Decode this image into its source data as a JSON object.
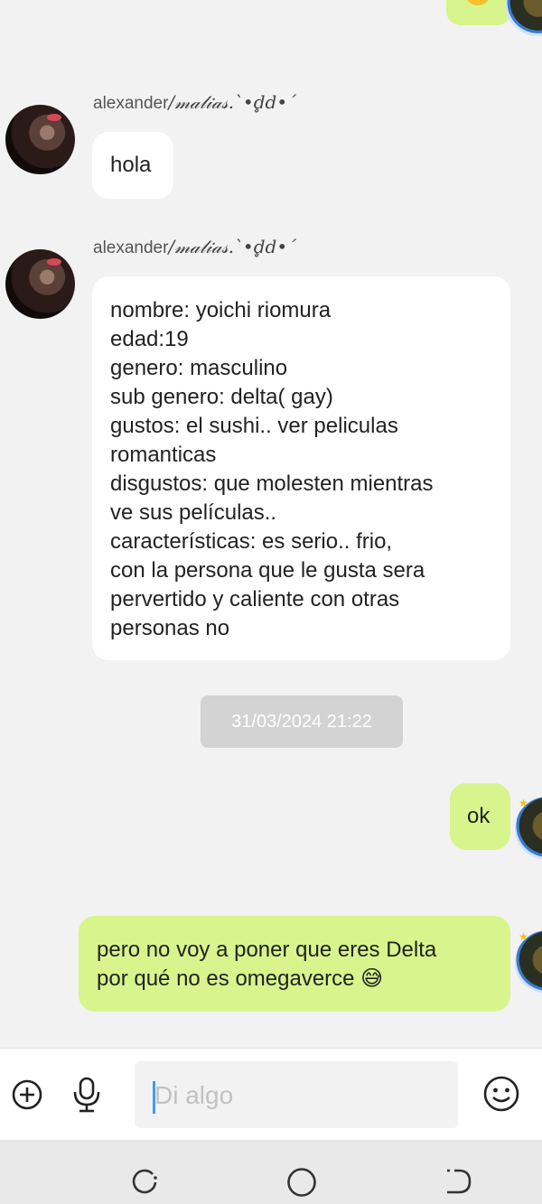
{
  "messages": [
    {
      "sender": "alexander",
      "sender_decoration": "/𝓂𝒶𝓁𝒾𝒶𝓈.`•d̥d•´",
      "text": "hola"
    },
    {
      "sender": "alexander",
      "sender_decoration": "/𝓂𝒶𝓁𝒾𝒶𝓈.`•d̥d•´",
      "lines": [
        "nombre: yoichi riomura",
        "edad:19",
        "genero: masculino",
        "sub genero: delta( gay)",
        "gustos: el sushi.. ver peliculas",
        "romanticas",
        "disgustos: que molesten mientras",
        "ve sus películas..",
        "características: es serio.. frio,",
        "con la persona que le gusta sera",
        "pervertido y caliente con otras",
        "personas no"
      ]
    },
    {
      "timestamp": "31/03/2024 21:22"
    },
    {
      "text": "ok"
    },
    {
      "lines": [
        "pero no voy a poner que eres Delta",
        "por qué no es omegaverce 😅"
      ]
    }
  ],
  "input": {
    "placeholder": "Di algo"
  },
  "icons": {
    "add": "plus-circle-icon",
    "mic": "microphone-icon",
    "emoji": "smiley-icon",
    "recents": "recents-icon",
    "home": "home-icon",
    "back": "back-icon"
  },
  "colors": {
    "outgoing_bubble": "#d7f58c",
    "incoming_bubble": "#ffffff",
    "background": "#f2f2f2",
    "caret": "#3d9df0"
  }
}
